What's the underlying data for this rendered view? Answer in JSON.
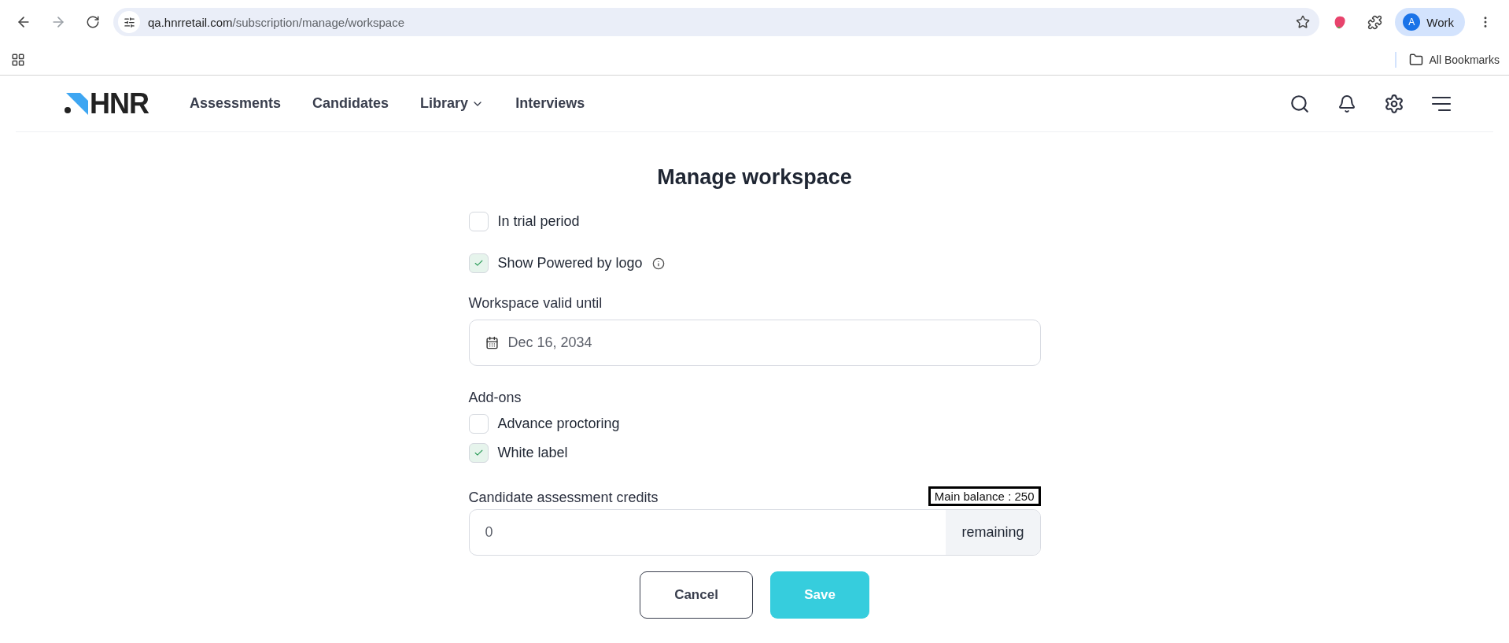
{
  "browser": {
    "url_host": "qa.hnrretail.com",
    "url_path": "/subscription/manage/workspace",
    "profile_initial": "A",
    "profile_label": "Work",
    "bookmarks_label": "All Bookmarks"
  },
  "nav": {
    "logo_text": "HNR",
    "items": [
      {
        "label": "Assessments",
        "kind": "link"
      },
      {
        "label": "Candidates",
        "kind": "link"
      },
      {
        "label": "Library",
        "kind": "dropdown"
      },
      {
        "label": "Interviews",
        "kind": "link"
      }
    ]
  },
  "page": {
    "title": "Manage workspace",
    "options": [
      {
        "label": "In trial period",
        "checked": false,
        "info": false
      },
      {
        "label": "Show Powered by logo",
        "checked": true,
        "info": true
      }
    ],
    "validity": {
      "label": "Workspace valid until",
      "value": "Dec 16, 2034"
    },
    "addons": {
      "label": "Add-ons",
      "options": [
        {
          "label": "Advance proctoring",
          "checked": false
        },
        {
          "label": "White label",
          "checked": true
        }
      ]
    },
    "credits": {
      "label": "Candidate assessment credits",
      "balance": "Main balance : 250",
      "value": "0",
      "suffix": "remaining"
    },
    "buttons": [
      {
        "label": "Cancel",
        "kind": "secondary"
      },
      {
        "label": "Save",
        "kind": "primary"
      }
    ]
  }
}
